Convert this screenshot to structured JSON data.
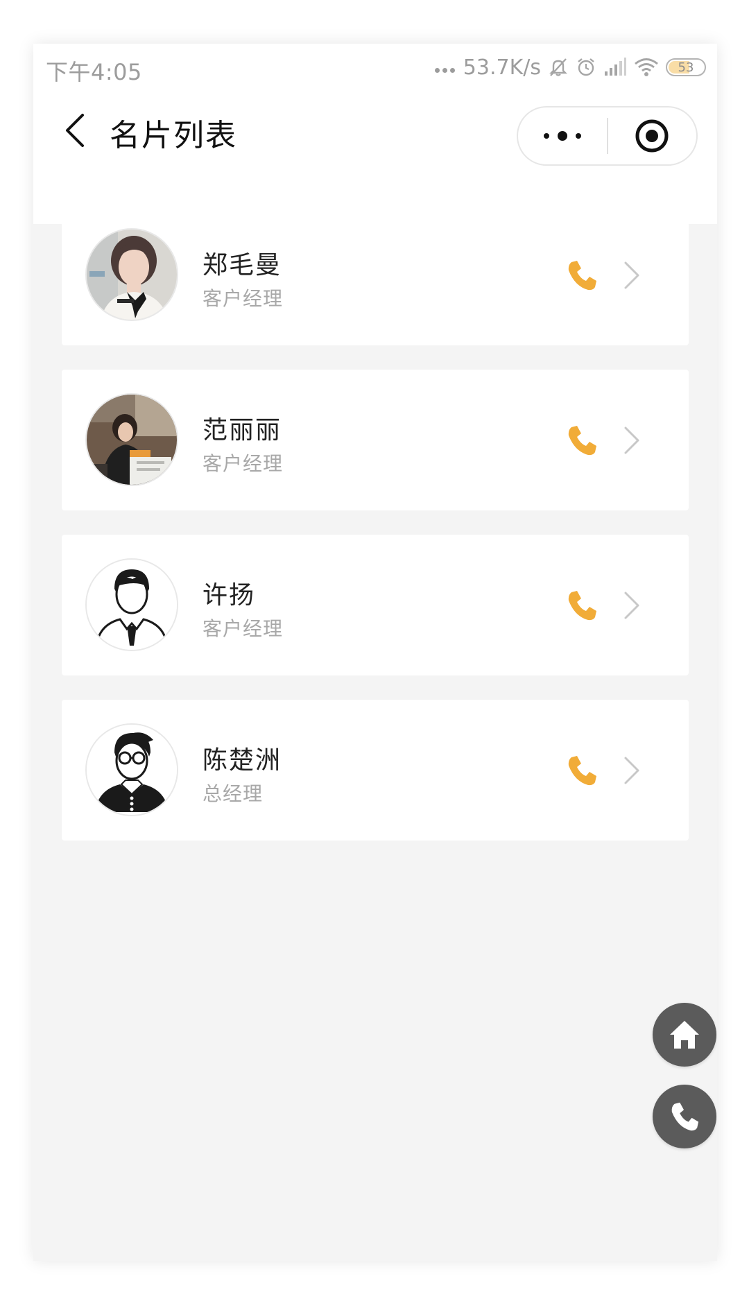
{
  "status_bar": {
    "time": "下午4:05",
    "net_speed": "53.7K/s",
    "battery": "53",
    "icons": [
      "mute-icon",
      "alarm-icon",
      "signal-icon",
      "wifi-icon",
      "battery-icon"
    ]
  },
  "nav": {
    "title": "名片列表",
    "back_icon": "back-chevron-icon",
    "more_icon": "more-dots-icon",
    "close_icon": "target-circle-icon"
  },
  "cards": [
    {
      "name": "郑毛曼",
      "title": "客户经理",
      "avatar": "photo"
    },
    {
      "name": "范丽丽",
      "title": "客户经理",
      "avatar": "photo"
    },
    {
      "name": "许扬",
      "title": "客户经理",
      "avatar": "cartoon-man-tie"
    },
    {
      "name": "陈楚洲",
      "title": "总经理",
      "avatar": "cartoon-man-glasses"
    }
  ],
  "fabs": {
    "home_icon": "home-icon",
    "call_icon": "phone-icon"
  },
  "colors": {
    "accent": "#f1ac38",
    "background": "#f4f4f4",
    "card": "#ffffff",
    "fab": "#5b5b5b",
    "subtitle": "#a8a8a8"
  }
}
